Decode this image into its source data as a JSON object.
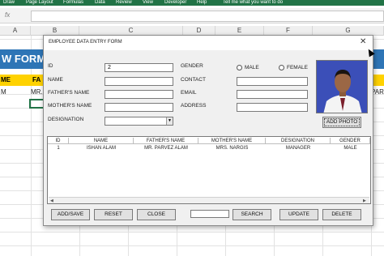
{
  "excel": {
    "ribbon_tabs": [
      "Draw",
      "Page Layout",
      "Formulas",
      "Data",
      "Review",
      "View",
      "Developer",
      "Help"
    ],
    "tell_me": "Tell me what you want to do",
    "fx": "fx",
    "columns": [
      "A",
      "B",
      "C",
      "D",
      "E",
      "F",
      "G"
    ],
    "banner_text": "W FORM",
    "band_left_text": "ME",
    "band_mid_text": "FA",
    "row_left_value": "M",
    "row_mid_value": "MR.",
    "row_right_value": "PARV"
  },
  "dialog": {
    "title": "EMPLOYEE DATA ENTRY FORM",
    "close_icon": "close-icon",
    "labels": {
      "id": "ID",
      "name": "NAME",
      "fathers_name": "FATHER'S NAME",
      "mothers_name": "MOTHER'S NAME",
      "designation": "DESIGNATION",
      "gender": "GENDER",
      "contact": "CONTACT",
      "email": "EMAIL",
      "address": "ADDRESS"
    },
    "values": {
      "id": "2",
      "name": "",
      "fathers_name": "",
      "mothers_name": "",
      "designation": "",
      "contact": "",
      "email": "",
      "address": ""
    },
    "gender_options": [
      "MALE",
      "FEMALE"
    ],
    "add_photo_label": "ADD PHOTO",
    "list": {
      "headers": [
        "ID",
        "NAME",
        "FATHER'S NAME",
        "MOTHER'S NAME",
        "DESIGNATION",
        "GENDER"
      ],
      "rows": [
        [
          "1",
          "ISHAN ALAM",
          "MR. PARVEZ ALAM",
          "MRS. NARGIS",
          "MANAGER",
          "MALE"
        ]
      ]
    },
    "buttons": {
      "add_save": "ADD/SAVE",
      "reset": "RESET",
      "close": "CLOSE",
      "search": "SEARCH",
      "update": "UPDATE",
      "delete": "DELETE"
    }
  },
  "colors": {
    "excel_green": "#217346",
    "banner_blue": "#2e75b6",
    "header_yellow": "#ffd200",
    "photo_background": "#3b4fb8"
  }
}
